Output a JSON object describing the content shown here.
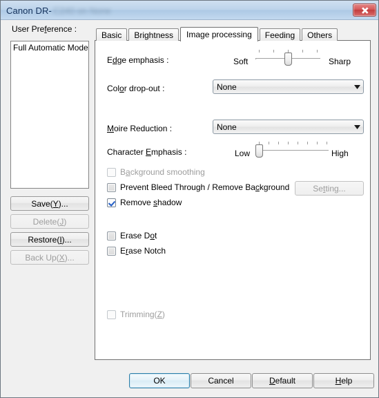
{
  "window": {
    "title_prefix": "Canon DR-",
    "title_redacted": "C240 on None",
    "close_icon": "close-icon"
  },
  "sidebar": {
    "pref_label": "User Preference :",
    "list_items": [
      "Full Automatic Mode"
    ],
    "buttons": [
      {
        "label": "Save(Y)...",
        "accel": "Y",
        "enabled": true
      },
      {
        "label": "Delete(J)",
        "accel": "J",
        "enabled": false
      },
      {
        "label": "Restore(I)...",
        "accel": "I",
        "enabled": true
      },
      {
        "label": "Back Up(X)...",
        "accel": "X",
        "enabled": false
      }
    ]
  },
  "tabs": [
    {
      "label": "Basic",
      "active": false
    },
    {
      "label": "Brightness",
      "active": false
    },
    {
      "label": "Image processing",
      "active": true
    },
    {
      "label": "Feeding",
      "active": false
    },
    {
      "label": "Others",
      "active": false
    }
  ],
  "main": {
    "edge_emphasis": {
      "label": "Edge emphasis :",
      "accel": "d",
      "min_label": "Soft",
      "max_label": "Sharp",
      "ticks": 5,
      "value": 3,
      "min": 1,
      "max": 5
    },
    "color_dropout": {
      "label": "Color drop-out :",
      "accel": "o",
      "value": "None"
    },
    "moire_reduction": {
      "label": "Moire Reduction :",
      "accel": "M",
      "value": "None"
    },
    "character_emphasis": {
      "label": "Character Emphasis :",
      "accel": "E",
      "min_label": "Low",
      "max_label": "High",
      "ticks": 8,
      "value": 1,
      "min": 1,
      "max": 8
    },
    "checkboxes": [
      {
        "label": "Background smoothing",
        "accel": "a",
        "checked": false,
        "enabled": false,
        "style": "pale"
      },
      {
        "label": "Prevent Bleed Through / Remove Background",
        "accel": "c",
        "checked": false,
        "enabled": true,
        "style": "filled"
      },
      {
        "label": "Remove shadow",
        "accel": "s",
        "checked": true,
        "enabled": true,
        "style": "checked"
      },
      {
        "label": "Erase Dot",
        "accel": "o",
        "checked": false,
        "enabled": true,
        "style": "filled"
      },
      {
        "label": "Erase Notch",
        "accel": "r",
        "checked": false,
        "enabled": true,
        "style": "filled"
      },
      {
        "label": "Trimming(Z)",
        "accel": "Z",
        "checked": false,
        "enabled": false,
        "style": "pale"
      }
    ],
    "setting_button": {
      "label": "Setting...",
      "accel": "t",
      "enabled": false
    }
  },
  "footer": {
    "buttons": [
      {
        "label": "OK",
        "default": true
      },
      {
        "label": "Cancel",
        "default": false
      },
      {
        "label": "Default",
        "accel": "D",
        "default": false
      },
      {
        "label": "Help",
        "accel": "H",
        "default": false
      }
    ]
  },
  "colors": {
    "title_gradient_top": "#cfe0f0",
    "title_text": "#14325c",
    "close_red": "#c23d3d",
    "dialog_face": "#f0f0f0",
    "page_white": "#ffffff",
    "check_blue": "#215dc6",
    "default_border": "#2b7ea8",
    "disabled_text": "#9d9d9d"
  }
}
